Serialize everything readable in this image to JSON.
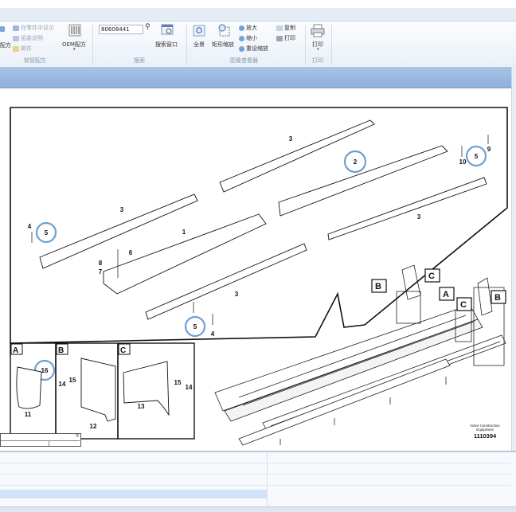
{
  "ribbon": {
    "left_partial_1": "",
    "left_partial_2": "配方",
    "show_in_parts": "在零件中显示",
    "assembly_desc": "组装说明",
    "mail": "邮件",
    "soft_pipe_group": "软管配方",
    "oem_label": "OEM配方",
    "search_value": "80608441",
    "search_window": "搜索窗口",
    "search_group": "搜索",
    "full_view": "全景",
    "rect_zoom": "矩形缩放",
    "zoom_in": "放大",
    "zoom_out": "缩小",
    "reset_zoom": "重设缩放",
    "copy": "复制",
    "print_small": "打印",
    "viewer_group": "图像查看器",
    "print_big": "打印",
    "print_group": "打印"
  },
  "diagram": {
    "callouts": [
      "1",
      "2",
      "3",
      "3",
      "3",
      "3",
      "4",
      "4",
      "5",
      "5",
      "5",
      "6",
      "7",
      "8",
      "9",
      "10",
      "11",
      "12",
      "13",
      "14",
      "14",
      "15",
      "15",
      "16"
    ],
    "detail_letters": [
      "A",
      "B",
      "C"
    ],
    "brand_line1": "Volvo Construction",
    "brand_line2": "Equipment",
    "drawing_number": "1110394"
  },
  "colors": {
    "ribbon_bg": "#eaf0f8",
    "band_blue": "#8fb0dc",
    "highlight_circle": "#6e9fd0",
    "selection": "#cfe2f8"
  }
}
